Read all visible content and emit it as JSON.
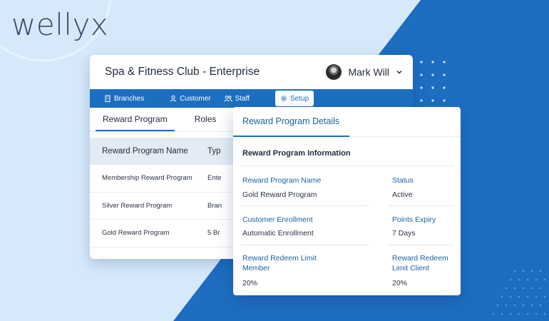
{
  "brand": {
    "logo_text": "wellyx"
  },
  "app": {
    "title": "Spa & Fitness Club - Enterprise"
  },
  "user": {
    "name": "Mark Will"
  },
  "nav": {
    "items": [
      {
        "label": "Branches",
        "icon": "building-icon"
      },
      {
        "label": "Customer",
        "icon": "user-icon"
      },
      {
        "label": "Staff",
        "icon": "users-icon"
      },
      {
        "label": "Setup",
        "icon": "gear-icon"
      }
    ],
    "active": "Setup"
  },
  "tabs": [
    {
      "label": "Reward Program",
      "active": true
    },
    {
      "label": "Roles",
      "active": false
    }
  ],
  "table": {
    "headers": [
      "Reward Program Name",
      "Typ"
    ],
    "rows": [
      {
        "name": "Membership Reward Program",
        "type": "Ente"
      },
      {
        "name": "Silver Reward Program",
        "type": "Bran"
      },
      {
        "name": "Gold Reward Program",
        "type": "5 Br"
      }
    ]
  },
  "details": {
    "tab": "Reward Program Details",
    "section_title": "Reward Program Information",
    "fields": {
      "program_name": {
        "label": "Reward Program Name",
        "value": "Gold Reward Program"
      },
      "status": {
        "label": "Status",
        "value": "Active"
      },
      "customer_enrollment": {
        "label": "Customer Enrollment",
        "value": "Automatic Enrollment"
      },
      "points_expiry": {
        "label": "Points Expiry",
        "value": "7 Days"
      },
      "redeem_limit_member": {
        "label_line1": "Reward Redeem Limit",
        "label_line2": "Member",
        "value": "20%"
      },
      "redeem_limit_client": {
        "label_line1": "Reward Redeem",
        "label_line2": "Limit Client",
        "value": "20%"
      }
    }
  },
  "colors": {
    "primary_blue": "#1c6fbf",
    "light_bg": "#d6e9fb",
    "dark_diagonal": "#1d6dc1",
    "table_header_bg": "#e3ebf5",
    "label_blue": "#1c5fa3"
  }
}
